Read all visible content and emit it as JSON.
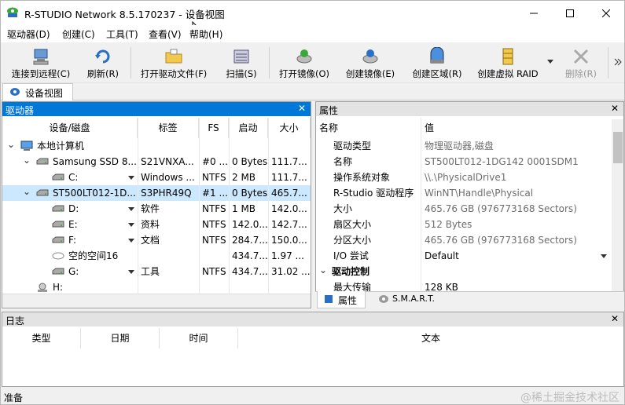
{
  "window": {
    "title": "R-STUDIO Network 8.5.170237 - 设备视图"
  },
  "menu": [
    "驱动器(D)",
    "创建(C)",
    "工具(T)",
    "查看(V)",
    "帮助(H)"
  ],
  "toolbar": [
    {
      "label": "连接到远程(C)",
      "icon": "computer-connect-icon"
    },
    {
      "label": "刷新(R)",
      "icon": "refresh-icon"
    },
    {
      "label": "打开驱动文件(F)",
      "icon": "open-folder-icon"
    },
    {
      "label": "扫描(S)",
      "icon": "scan-icon"
    },
    {
      "label": "打开镜像(O)",
      "icon": "open-image-icon"
    },
    {
      "label": "创建镜像(E)",
      "icon": "create-image-icon"
    },
    {
      "label": "创建区域(R)",
      "icon": "create-region-icon"
    },
    {
      "label": "创建虚拟 RAID",
      "icon": "raid-icon"
    },
    {
      "label": "删除(R)",
      "icon": "delete-icon"
    }
  ],
  "doc_tab": "设备视图",
  "drives_panel": {
    "title": "驱动器",
    "columns": [
      "设备/磁盘",
      "标签",
      "FS",
      "启动",
      "大小"
    ],
    "rows": [
      {
        "name": "本地计算机",
        "label": "",
        "fs": "",
        "start": "",
        "size": ""
      },
      {
        "name": "Samsung SSD 8...",
        "label": "S21VNXA...",
        "fs": "#0 ...",
        "start": "0 Bytes",
        "size": "111.7..."
      },
      {
        "name": "C:",
        "label": "Windows ...",
        "fs": "NTFS",
        "start": "2 MB",
        "size": "111.7..."
      },
      {
        "name": "ST500LT012-1D...",
        "label": "S3PHR49Q",
        "fs": "#1 ...",
        "start": "0 Bytes",
        "size": "465.7..."
      },
      {
        "name": "D:",
        "label": "软件",
        "fs": "NTFS",
        "start": "1 MB",
        "size": "142.0..."
      },
      {
        "name": "E:",
        "label": "资料",
        "fs": "NTFS",
        "start": "142.0...",
        "size": "142.7..."
      },
      {
        "name": "F:",
        "label": "文档",
        "fs": "NTFS",
        "start": "284.7...",
        "size": "150.0..."
      },
      {
        "name": "空的空间16",
        "label": "",
        "fs": "",
        "start": "434.7...",
        "size": "1.97 ..."
      },
      {
        "name": "G:",
        "label": "工具",
        "fs": "NTFS",
        "start": "434.7...",
        "size": "31.02 ..."
      },
      {
        "name": "H:",
        "label": "",
        "fs": "",
        "start": "",
        "size": ""
      }
    ]
  },
  "props_panel": {
    "title": "属性",
    "columns": [
      "名称",
      "值"
    ],
    "rows": [
      {
        "name": "驱动类型",
        "value": "物理驱动器,磁盘"
      },
      {
        "name": "名称",
        "value": "ST500LT012-1DG142 0001SDM1"
      },
      {
        "name": "操作系统对象",
        "value": "\\\\.\\PhysicalDrive1"
      },
      {
        "name": "R-Studio 驱动程序",
        "value": "WinNT\\Handle\\Physical"
      },
      {
        "name": "大小",
        "value": "465.76 GB (976773168 Sectors)"
      },
      {
        "name": "扇区大小",
        "value": "512 Bytes"
      },
      {
        "name": "分区大小",
        "value": "465.76 GB (976773168 Sectors)"
      },
      {
        "name": "I/O 尝试",
        "value": "Default"
      },
      {
        "name": "驱动控制",
        "value": ""
      },
      {
        "name": "最大传输",
        "value": "128 KB"
      }
    ],
    "tabs": [
      "属性",
      "S.M.A.R.T."
    ]
  },
  "log_panel": {
    "title": "日志",
    "columns": [
      "类型",
      "日期",
      "时间",
      "文本"
    ]
  },
  "status": "准备",
  "watermark": "@稀土掘金技术社区",
  "colors": {
    "panel_header_active": "#0078d7",
    "panel_header_inactive": "#e3e3e3",
    "selection": "#cce8ff"
  }
}
